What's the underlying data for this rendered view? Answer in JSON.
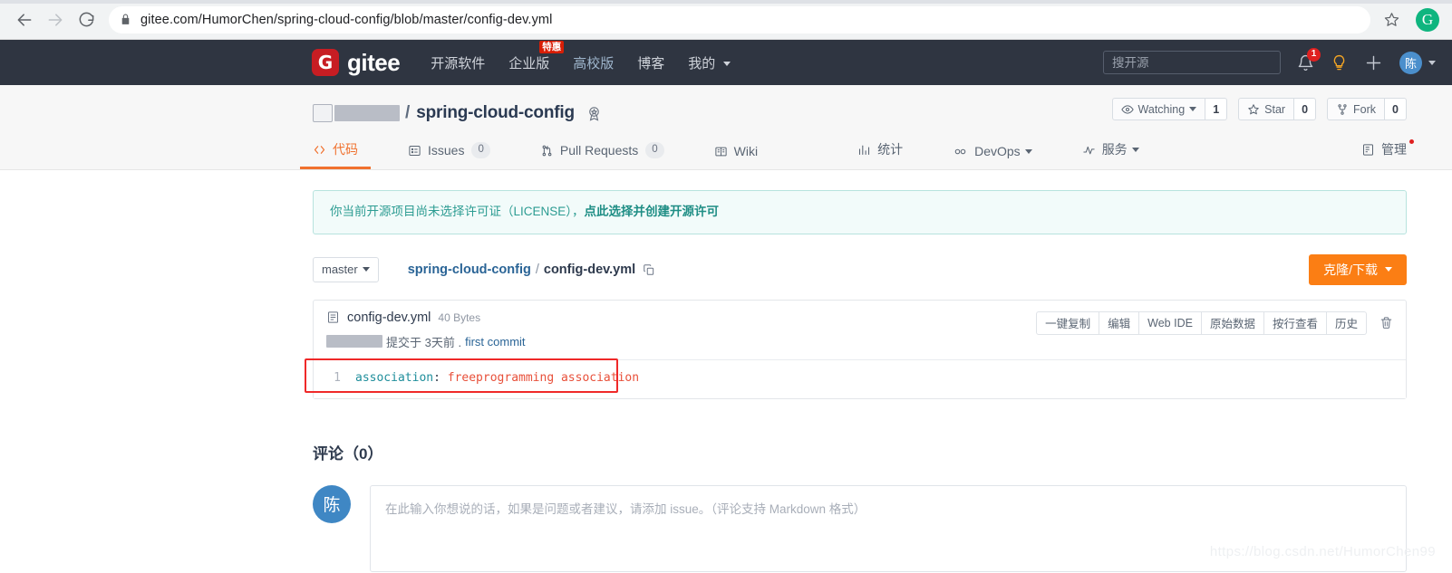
{
  "browser": {
    "url_display": "gitee.com/HumorChen/spring-cloud-config/blob/master/config-dev.yml",
    "back_icon": "back-arrow-icon",
    "forward_icon": "forward-arrow-icon",
    "reload_icon": "reload-icon",
    "lock_icon": "lock-icon",
    "bookmark_icon": "star-icon",
    "profile_initial": "G"
  },
  "topnav": {
    "logo_letter": "G",
    "brand": "gitee",
    "links": [
      {
        "label": "开源软件",
        "badge": ""
      },
      {
        "label": "企业版",
        "badge": "特惠"
      },
      {
        "label": "高校版",
        "badge": ""
      },
      {
        "label": "博客",
        "badge": ""
      },
      {
        "label": "我的",
        "badge": "",
        "caret": true
      }
    ],
    "search_placeholder": "搜开源",
    "bell_icon": "bell-icon",
    "bell_count": "1",
    "bulb_icon": "lightbulb-icon",
    "plus_icon": "plus-icon",
    "avatar_initial": "陈"
  },
  "repo": {
    "owner_redacted": true,
    "separator": "/",
    "name": "spring-cloud-config",
    "badge_icon": "award-badge-icon",
    "actions": [
      {
        "label": "Watching",
        "icon": "eye-icon",
        "count": "1",
        "caret": true
      },
      {
        "label": "Star",
        "icon": "star-outline-icon",
        "count": "0",
        "caret": false
      },
      {
        "label": "Fork",
        "icon": "fork-icon",
        "count": "0",
        "caret": false
      }
    ],
    "tabs": [
      {
        "label": "代码",
        "icon": "code-icon",
        "count": "",
        "active": true
      },
      {
        "label": "Issues",
        "icon": "issue-icon",
        "count": "0",
        "active": false
      },
      {
        "label": "Pull Requests",
        "icon": "pull-request-icon",
        "count": "0",
        "active": false
      },
      {
        "label": "Wiki",
        "icon": "wiki-icon",
        "count": "",
        "active": false
      },
      {
        "label": "统计",
        "icon": "chart-icon",
        "count": "",
        "active": false
      },
      {
        "label": "DevOps",
        "icon": "infinity-icon",
        "count": "",
        "active": false,
        "caret": true
      },
      {
        "label": "服务",
        "icon": "pulse-icon",
        "count": "",
        "active": false,
        "caret": true
      },
      {
        "label": "管理",
        "icon": "manage-icon",
        "count": "",
        "active": false,
        "dot": true
      }
    ]
  },
  "license_banner": {
    "text": "你当前开源项目尚未选择许可证（LICENSE），",
    "link": "点此选择并创建开源许可"
  },
  "path_bar": {
    "branch": "master",
    "breadcrumb_repo": "spring-cloud-config",
    "breadcrumb_sep": "/",
    "breadcrumb_file": "config-dev.yml",
    "copy_icon": "copy-icon",
    "clone_button": "克隆/下载"
  },
  "file": {
    "icon": "file-text-icon",
    "name": "config-dev.yml",
    "size": "40 Bytes",
    "commit_text": "提交于 3天前 .",
    "commit_message": "first commit",
    "actions": [
      "一键复制",
      "编辑",
      "Web IDE",
      "原始数据",
      "按行查看",
      "历史"
    ],
    "delete_icon": "trash-icon",
    "code_lines": [
      {
        "num": "1",
        "key": "association",
        "punc": ":",
        "value": "freeprogramming association"
      }
    ]
  },
  "comments": {
    "title": "评论（0）",
    "avatar_initial": "陈",
    "placeholder": "在此输入你想说的话，如果是问题或者建议，请添加 issue。（评论支持 Markdown 格式）"
  },
  "watermark": "https://blog.csdn.net/HumorChen99"
}
